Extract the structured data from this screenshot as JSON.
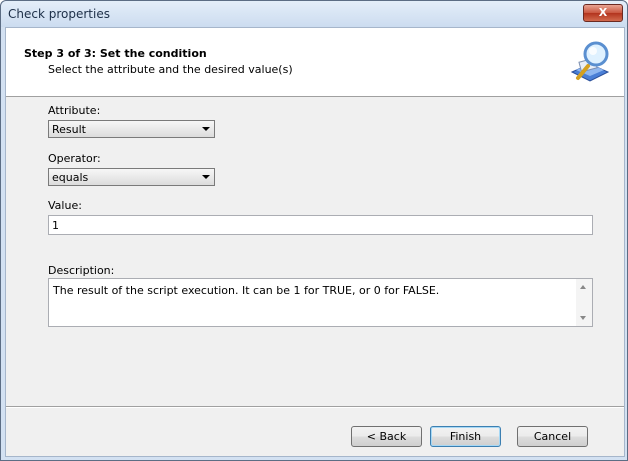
{
  "window": {
    "title": "Check properties",
    "close_label": "X"
  },
  "header": {
    "step_title": "Step 3 of 3: Set the condition",
    "step_subtitle": "Select the attribute and the desired value(s)",
    "icon": "magnifier-wizard-icon"
  },
  "form": {
    "attribute_label": "Attribute:",
    "attribute_value": "Result",
    "operator_label": "Operator:",
    "operator_value": "equals",
    "value_label": "Value:",
    "value_value": "1",
    "description_label": "Description:",
    "description_text": "The result of the script execution. It can be 1 for TRUE, or 0 for FALSE."
  },
  "buttons": {
    "back": "< Back",
    "finish": "Finish",
    "cancel": "Cancel"
  },
  "colors": {
    "title_bar": "#ccdcf0",
    "close_button": "#c9563f",
    "default_button_border": "#3c7fb1"
  }
}
